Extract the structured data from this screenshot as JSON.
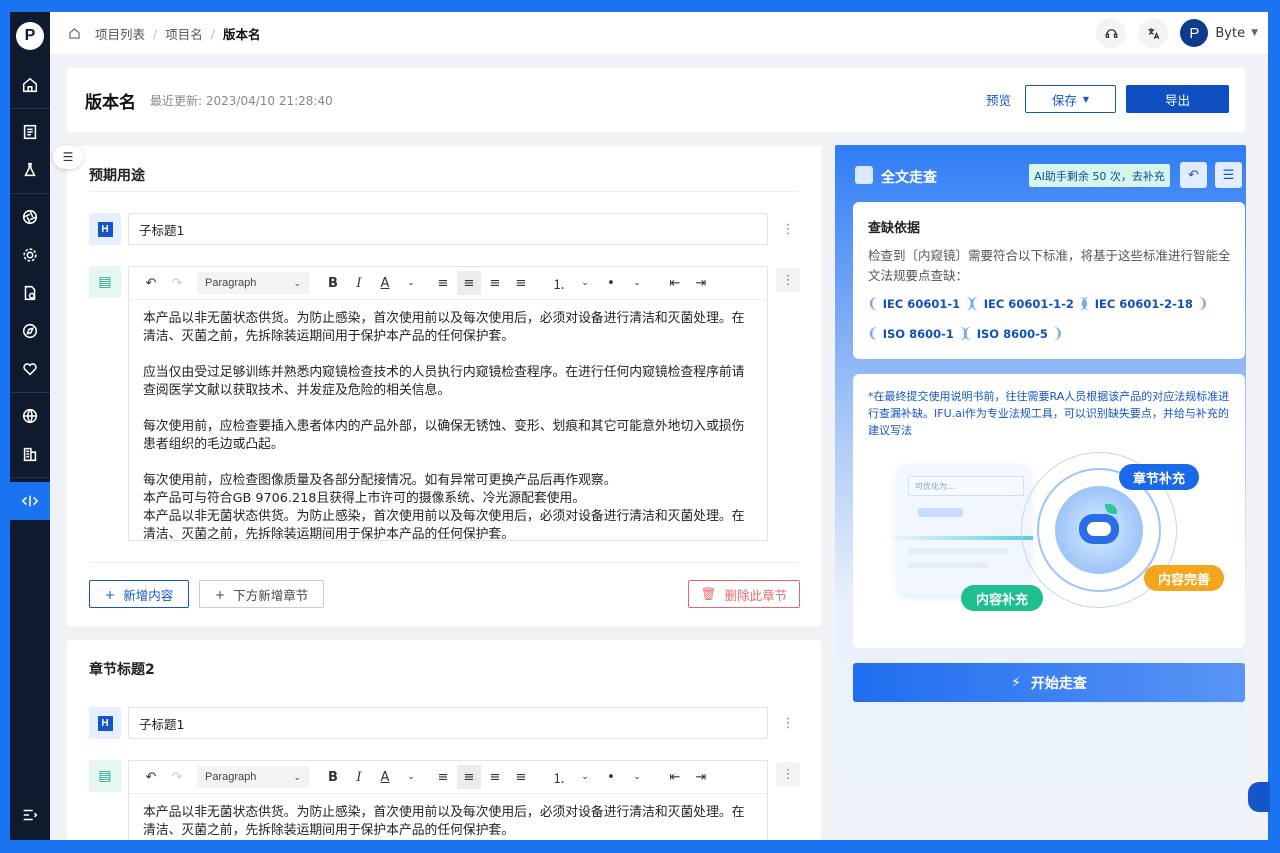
{
  "breadcrumb": {
    "items": [
      "项目列表",
      "项目名"
    ],
    "current": "版本名"
  },
  "user": {
    "avatar_letter": "P",
    "name": "Byte"
  },
  "header": {
    "title": "版本名",
    "last_updated": "最近更新: 2023/04/10 21:28:40",
    "preview_label": "预览",
    "save_label": "保存",
    "export_label": "导出"
  },
  "sections": [
    {
      "title": "预期用途",
      "subtitle_value": "子标题1",
      "paragraph_format": "Paragraph",
      "paragraphs": [
        "本产品以非无菌状态供货。为防止感染，首次使用前以及每次使用后，必须对设备进行清洁和灭菌处理。在清洁、灭菌之前，先拆除装运期间用于保护本产品的任何保护套。",
        "应当仅由受过足够训练并熟悉内窥镜检查技术的人员执行内窥镜检查程序。在进行任何内窥镜检查程序前请查阅医学文献以获取技术、并发症及危险的相关信息。",
        "每次使用前，应检查要插入患者体内的产品外部，以确保无锈蚀、变形、划痕和其它可能意外地切入或损伤患者组织的毛边或凸起。",
        "每次使用前，应检查图像质量及各部分配接情况。如有异常可更换产品后再作观察。",
        "本产品可与符合GB 9706.218且获得上市许可的摄像系统、冷光源配套使用。",
        "本产品以非无菌状态供货。为防止感染，首次使用前以及每次使用后，必须对设备进行清洁和灭菌处理。在清洁、灭菌之前，先拆除装运期间用于保护本产品的任何保护套。"
      ],
      "add_content_label": "新增内容",
      "add_section_below_label": "下方新增章节",
      "delete_section_label": "删除此章节"
    },
    {
      "title": "章节标题2",
      "subtitle_value": "子标题1",
      "paragraph_format": "Paragraph",
      "paragraphs": [
        "本产品以非无菌状态供货。为防止感染，首次使用前以及每次使用后，必须对设备进行清洁和灭菌处理。在清洁、灭菌之前，先拆除装运期间用于保护本产品的任何保护套。"
      ]
    }
  ],
  "panel": {
    "title": "全文走查",
    "ai_badge": "AI助手剩余 50 次，去补充",
    "basis_title": "查缺依据",
    "basis_text": "检查到〔内窥镜〕需要符合以下标准，将基于这些标准进行智能全文法规要点查缺：",
    "standards": [
      "IEC 60601-1",
      "IEC 60601-1-2",
      "IEC 60601-2-18",
      "ISO 8600-1",
      "ISO 8600-5"
    ],
    "note": "*在最终提交使用说明书前，往往需要RA人员根据该产品的对应法规标准进行查漏补缺。IFU.ai作为专业法规工具，可以识别缺失要点，并给与补充的建议写法",
    "illus_input_placeholder": "可优化为...",
    "tags": [
      "章节补充",
      "内容完善",
      "内容补充"
    ],
    "start_label": "开始走查"
  },
  "colors": {
    "primary": "#0f4fbf",
    "danger": "#e56a6a",
    "sidebar": "#0e1a2e",
    "teal": "#1aa88a"
  }
}
